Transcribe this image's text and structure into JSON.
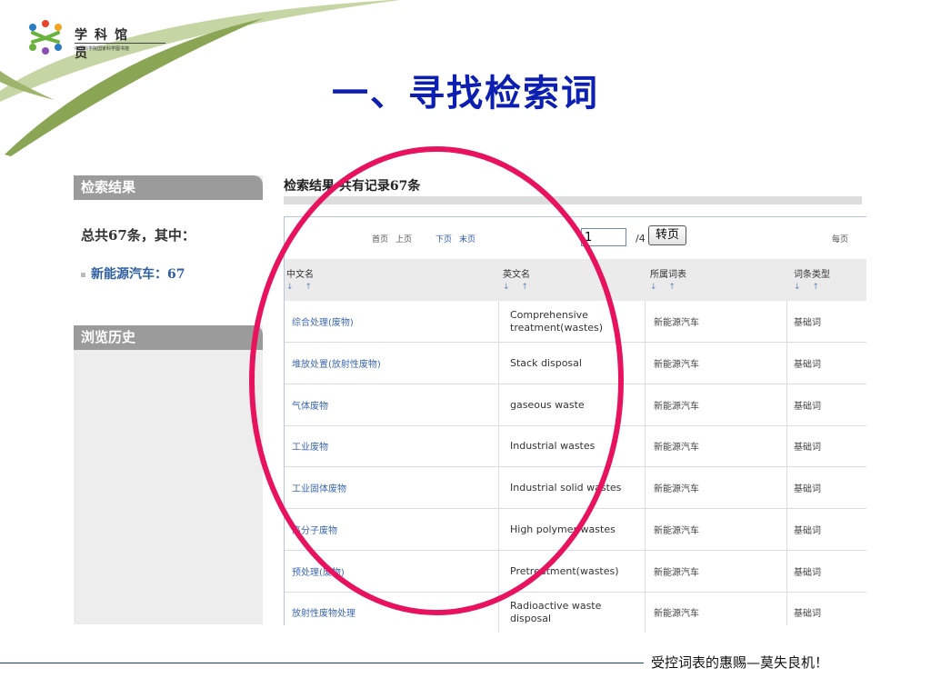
{
  "logo": {
    "name": "学科馆员",
    "subtitle": "中国科学院国家科学图书馆"
  },
  "slide_title": "一、寻找检索词",
  "sidebar": {
    "results_heading": "检索结果",
    "total_text": "总共67条，其中：",
    "category_item": "新能源汽车：67",
    "history_heading": "浏览历史"
  },
  "main": {
    "title": "检索结果 共有记录67条",
    "pager": {
      "first": "首页",
      "prev": "上页",
      "next": "下页",
      "last": "末页",
      "page_value": "1",
      "total_pages": "/4",
      "go_button": "转页",
      "per_page": "每页"
    },
    "columns": [
      {
        "label": "中文名",
        "sort": "↓ ↑"
      },
      {
        "label": "英文名",
        "sort": "↓ ↑"
      },
      {
        "label": "所属词表",
        "sort": "↓ ↑"
      },
      {
        "label": "词条类型",
        "sort": "↓ ↑"
      }
    ],
    "rows": [
      {
        "zh": "综合处理(废物)",
        "en": "Comprehensive treatment(wastes)",
        "vocab": "新能源汽车",
        "type": "基础词"
      },
      {
        "zh": "堆放处置(放射性废物)",
        "en": "Stack disposal",
        "vocab": "新能源汽车",
        "type": "基础词"
      },
      {
        "zh": "气体废物",
        "en": "gaseous waste",
        "vocab": "新能源汽车",
        "type": "基础词"
      },
      {
        "zh": "工业废物",
        "en": "Industrial wastes",
        "vocab": "新能源汽车",
        "type": "基础词"
      },
      {
        "zh": "工业固体废物",
        "en": "Industrial solid wastes",
        "vocab": "新能源汽车",
        "type": "基础词"
      },
      {
        "zh": "高分子废物",
        "en": "High polymer wastes",
        "vocab": "新能源汽车",
        "type": "基础词"
      },
      {
        "zh": "预处理(废物)",
        "en": "Pretreatment(wastes)",
        "vocab": "新能源汽车",
        "type": "基础词"
      },
      {
        "zh": "放射性废物处理",
        "en": "Radioactive waste disposal",
        "vocab": "新能源汽车",
        "type": "基础词"
      }
    ]
  },
  "footer_text": "受控词表的惠赐—莫失良机！",
  "colors": {
    "title_blue": "#0c1fb0",
    "highlight_ellipse": "#e8135f",
    "decor_green": "#8aa655"
  }
}
